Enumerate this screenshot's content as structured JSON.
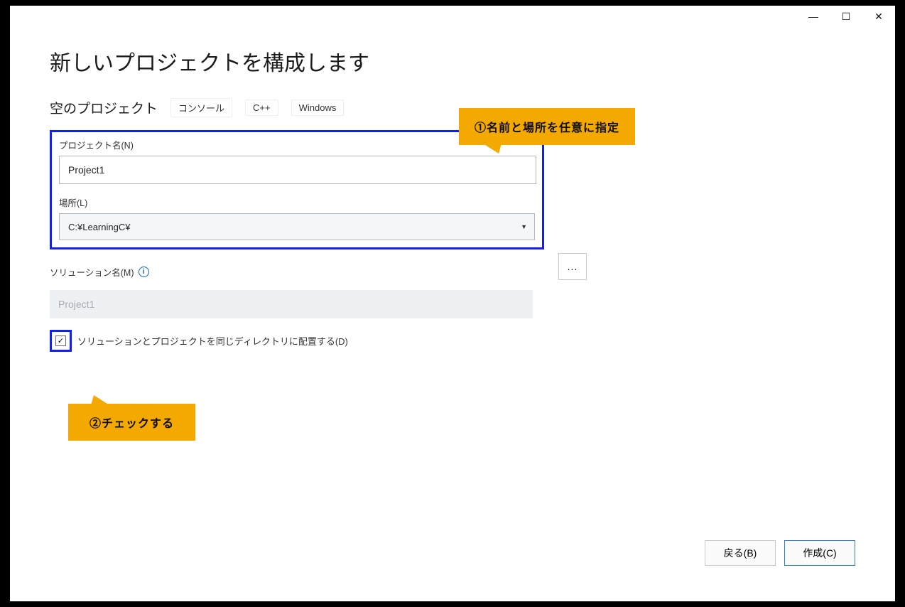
{
  "titlebar": {
    "minimize": "—",
    "maximize": "☐",
    "close": "✕"
  },
  "header": {
    "title": "新しいプロジェクトを構成します",
    "subtitle": "空のプロジェクト",
    "tags": [
      "コンソール",
      "C++",
      "Windows"
    ]
  },
  "fields": {
    "project_name_label": "プロジェクト名(N)",
    "project_name_value": "Project1",
    "location_label": "場所(L)",
    "location_value": "C:¥LearningC¥",
    "browse_label": "...",
    "solution_name_label": "ソリューション名(M)",
    "solution_name_value": "Project1",
    "checkbox_label": "ソリューションとプロジェクトを同じディレクトリに配置する(D)",
    "checkbox_mark": "✓",
    "dropdown_arrow": "▼"
  },
  "callouts": {
    "c1": "①名前と場所を任意に指定",
    "c2": "②チェックする"
  },
  "footer": {
    "back": "戻る(B)",
    "create": "作成(C)"
  }
}
